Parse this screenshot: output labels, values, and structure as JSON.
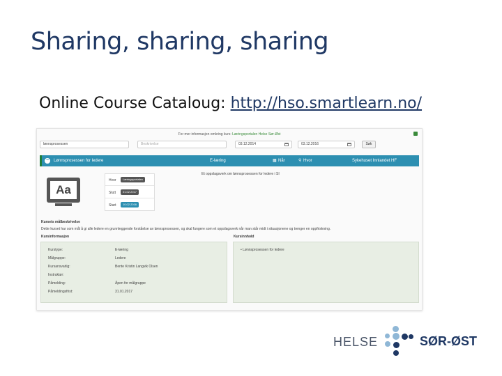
{
  "slide": {
    "title": "Sharing, sharing, sharing",
    "subtitle_prefix": "Online Course Cataloug: ",
    "subtitle_link": "http://hso.smartlearn.no/"
  },
  "screenshot": {
    "info_prefix": "For mer informasjon omkring kurs: ",
    "info_link": "Læringsportalen Helse Sør-Øst",
    "search": {
      "keyword_value": "lønnsprosessen",
      "description_placeholder": "Beskrivelse",
      "date_from": "03.12.2014",
      "date_to": "03.12.2016",
      "button_label": "Søk"
    },
    "course": {
      "title": "Lønnsprosessen for ledere",
      "type": "E-læring",
      "when_label": "Når",
      "where_label": "Hvor",
      "organization": "Sykehuset Innlandet HF",
      "short_description": "Et oppslagsverk om lønnsprosessen for ledere i SI",
      "icon_text": "Aa",
      "details": [
        {
          "label": "Hvor",
          "value": "Læringsportalen"
        },
        {
          "label": "Slutt",
          "value": "01.02.2017"
        },
        {
          "label": "Start",
          "value": "10.02.2016"
        }
      ]
    },
    "goal_section": {
      "title": "Kursets målbeskrivelse",
      "text": "Dette kurset har som mål å gi alle ledere en grunnleggende forståelse av lønnsprosessen, og skal fungere som et oppslagsverk når man står midt i situasjonene og trenger en oppfriskning."
    },
    "course_info": {
      "title": "Kursinformasjon",
      "rows": [
        {
          "key": "Kurstype:",
          "value": "E-læring"
        },
        {
          "key": "Målgruppe:",
          "value": "Ledere"
        },
        {
          "key": "Kursansvarlig:",
          "value": "Bente Kristin Langvik Olsen"
        },
        {
          "key": "Instruktør:",
          "value": ""
        },
        {
          "key": "Påmelding:",
          "value": "Åpen for målgruppe"
        },
        {
          "key": "Påmeldingsfrist:",
          "value": "31.01.2017"
        }
      ]
    },
    "course_content": {
      "title": "Kursinnhold",
      "items": [
        "Lønnsprosessen for ledere"
      ]
    }
  },
  "logo": {
    "left_word": "HELSE",
    "right_word": "SØR-ØST"
  },
  "colors": {
    "title": "#1f3864",
    "course_bar": "#2d8fb1",
    "panel": "#e8eee4",
    "logo_dot_light": "#8fb7d6",
    "logo_dot_dark": "#1f3864"
  }
}
